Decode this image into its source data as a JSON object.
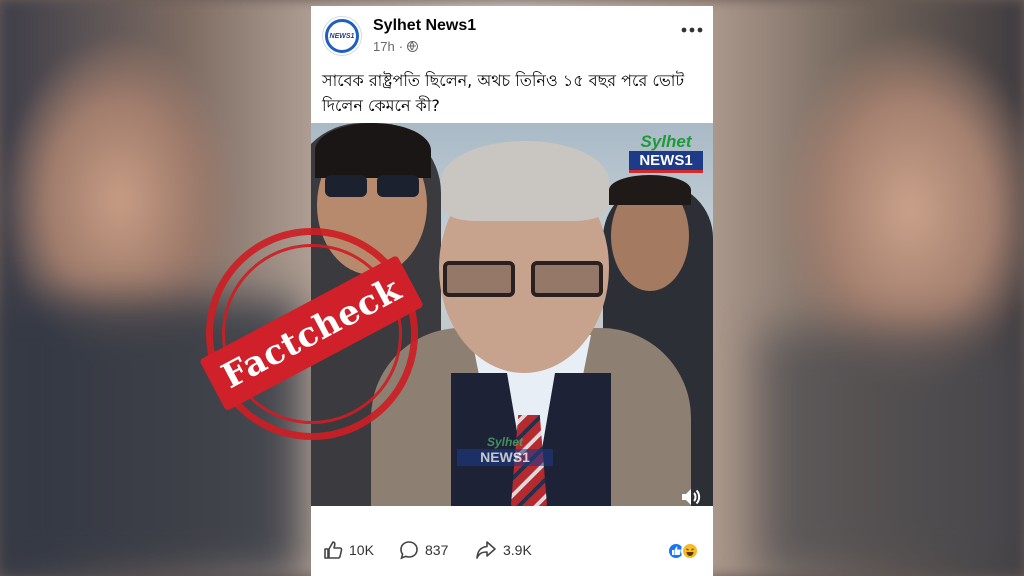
{
  "post": {
    "page_name": "Sylhet News1",
    "time": "17h",
    "separator": "·",
    "caption": "সাবেক রাষ্ট্রপতি ছিলেন, অথচ তিনিও ১৫ বছর পরে ভোট দিলেন কেমনে কী?",
    "more_icon": "more-horizontal-icon",
    "privacy_icon": "globe-icon"
  },
  "media": {
    "logo_top": "Sylhet",
    "logo_bottom": "NEWS1",
    "watermark_top": "Sylhet",
    "watermark_bottom": "NEWS1"
  },
  "stats": {
    "likes": "10K",
    "comments": "837",
    "shares": "3.9K"
  },
  "stamp": {
    "label": "Factcheck",
    "color": "#d0202a"
  },
  "colors": {
    "brand_blue": "#1e3b8a",
    "brand_green": "#1f9a3a",
    "like_blue": "#1877f2"
  }
}
